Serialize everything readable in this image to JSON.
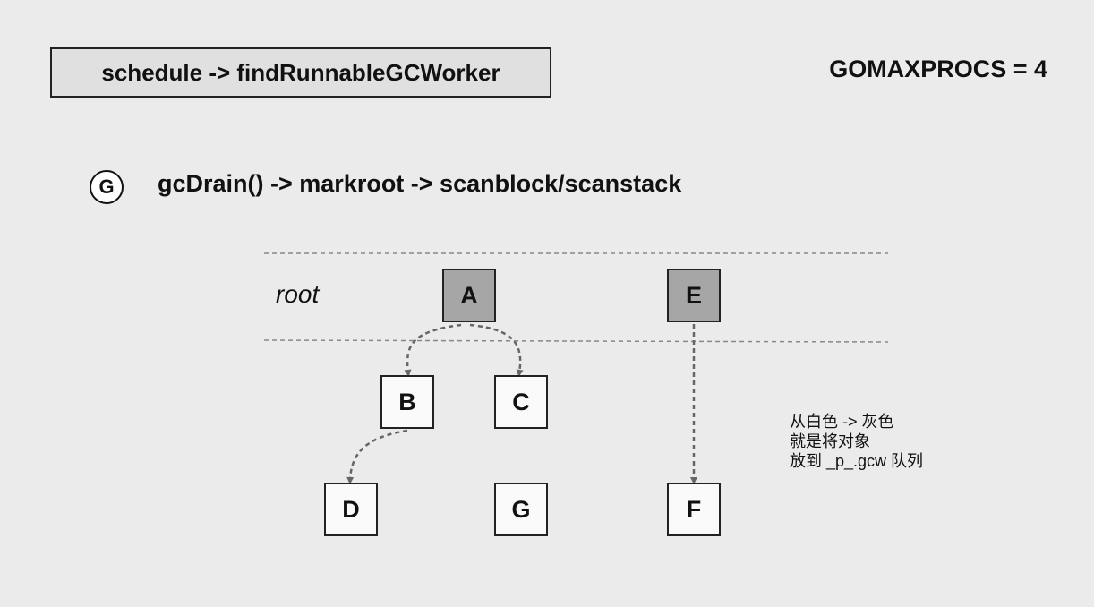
{
  "header": {
    "title": "schedule -> findRunnableGCWorker",
    "gomaxprocs": "GOMAXPROCS = 4"
  },
  "goroutine": {
    "badge": "G",
    "call_chain": "gcDrain() -> markroot -> scanblock/scanstack"
  },
  "diagram": {
    "root_label": "root",
    "nodes": {
      "A": {
        "label": "A",
        "color": "gray"
      },
      "E": {
        "label": "E",
        "color": "gray"
      },
      "B": {
        "label": "B",
        "color": "white"
      },
      "C": {
        "label": "C",
        "color": "white"
      },
      "D": {
        "label": "D",
        "color": "white"
      },
      "G": {
        "label": "G",
        "color": "white"
      },
      "F": {
        "label": "F",
        "color": "white"
      }
    },
    "edges": [
      [
        "A",
        "B"
      ],
      [
        "A",
        "C"
      ],
      [
        "B",
        "D"
      ],
      [
        "E",
        "F"
      ]
    ],
    "colors": {
      "gray_node": "#a6a6a6",
      "white_node": "#fafafa",
      "edge": "#666666"
    }
  },
  "note": {
    "lines": [
      "从白色 -> 灰色",
      "就是将对象",
      "放到 _p_.gcw 队列"
    ]
  }
}
